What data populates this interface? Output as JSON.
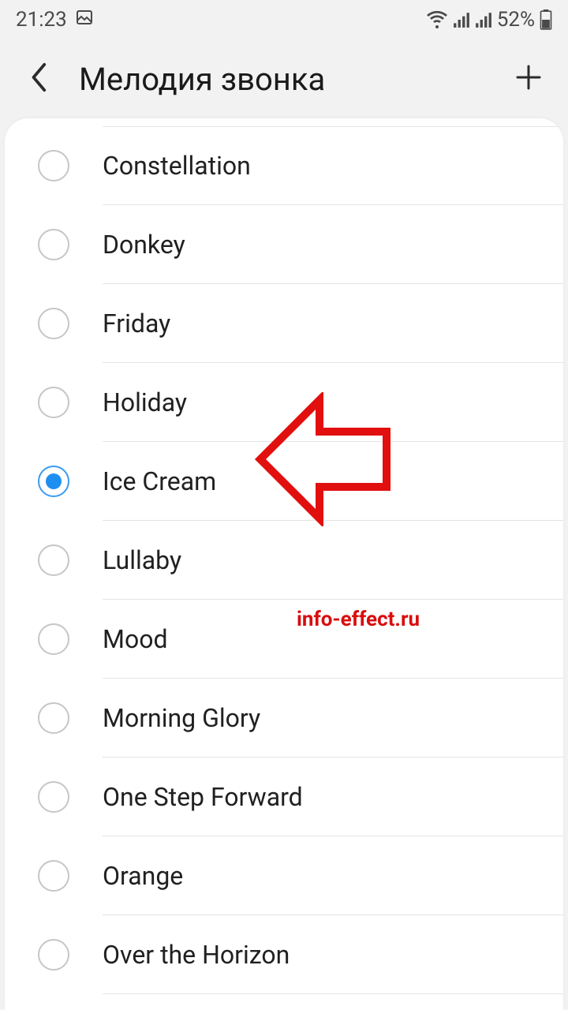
{
  "statusbar": {
    "time": "21:23",
    "battery_pct": "52%"
  },
  "header": {
    "title": "Мелодия звонка"
  },
  "ringtones": [
    {
      "label": "Constellation",
      "selected": false
    },
    {
      "label": "Donkey",
      "selected": false
    },
    {
      "label": "Friday",
      "selected": false
    },
    {
      "label": "Holiday",
      "selected": false
    },
    {
      "label": "Ice Cream",
      "selected": true
    },
    {
      "label": "Lullaby",
      "selected": false
    },
    {
      "label": "Mood",
      "selected": false
    },
    {
      "label": "Morning Glory",
      "selected": false
    },
    {
      "label": "One Step Forward",
      "selected": false
    },
    {
      "label": "Orange",
      "selected": false
    },
    {
      "label": "Over the Horizon",
      "selected": false
    }
  ],
  "watermark": "info-effect.ru"
}
